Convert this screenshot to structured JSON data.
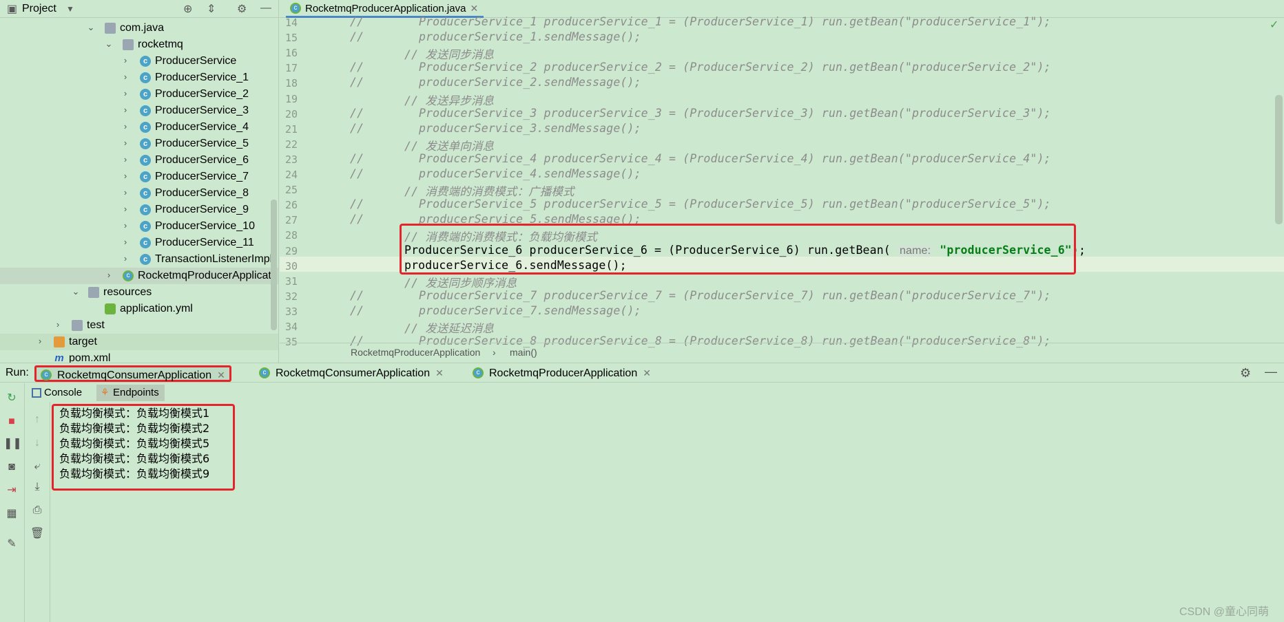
{
  "project": {
    "title": "Project",
    "tree": [
      {
        "label": "com.java",
        "icon": "folder-icon",
        "depth": "pkg"
      },
      {
        "label": "rocketmq",
        "icon": "folder-icon",
        "depth": "sub"
      },
      {
        "label": "ProducerService",
        "icon": "class-icon"
      },
      {
        "label": "ProducerService_1",
        "icon": "class-icon"
      },
      {
        "label": "ProducerService_2",
        "icon": "class-icon"
      },
      {
        "label": "ProducerService_3",
        "icon": "class-icon"
      },
      {
        "label": "ProducerService_4",
        "icon": "class-icon"
      },
      {
        "label": "ProducerService_5",
        "icon": "class-icon"
      },
      {
        "label": "ProducerService_6",
        "icon": "class-icon"
      },
      {
        "label": "ProducerService_7",
        "icon": "class-icon"
      },
      {
        "label": "ProducerService_8",
        "icon": "class-icon"
      },
      {
        "label": "ProducerService_9",
        "icon": "class-icon"
      },
      {
        "label": "ProducerService_10",
        "icon": "class-icon"
      },
      {
        "label": "ProducerService_11",
        "icon": "class-icon"
      },
      {
        "label": "TransactionListenerImpl",
        "icon": "class-icon"
      },
      {
        "label": "RocketmqProducerApplicati",
        "icon": "spring-boot-class-icon"
      },
      {
        "label": "resources",
        "icon": "resources-folder-icon"
      },
      {
        "label": "application.yml",
        "icon": "yml-icon"
      },
      {
        "label": "test",
        "icon": "folder-icon"
      },
      {
        "label": "target",
        "icon": "orange-folder-icon"
      },
      {
        "label": "pom.xml",
        "icon": "maven-icon"
      }
    ]
  },
  "editor": {
    "tab_label": "RocketmqProducerApplication.java",
    "line_numbers": [
      "14",
      "15",
      "16",
      "17",
      "18",
      "19",
      "20",
      "21",
      "22",
      "23",
      "24",
      "25",
      "26",
      "27",
      "28",
      "29",
      "30",
      "31",
      "32",
      "33",
      "34",
      "35"
    ],
    "lines": [
      {
        "prefix": "//",
        "text": "ProducerService_1 producerService_1 = (ProducerService_1) run.getBean(\"producerService_1\");"
      },
      {
        "prefix": "//",
        "text": "producerService_1.sendMessage();"
      },
      {
        "prefix": "",
        "text": "// 发送同步消息"
      },
      {
        "prefix": "//",
        "text": "ProducerService_2 producerService_2 = (ProducerService_2) run.getBean(\"producerService_2\");"
      },
      {
        "prefix": "//",
        "text": "producerService_2.sendMessage();"
      },
      {
        "prefix": "",
        "text": "// 发送异步消息"
      },
      {
        "prefix": "//",
        "text": "ProducerService_3 producerService_3 = (ProducerService_3) run.getBean(\"producerService_3\");"
      },
      {
        "prefix": "//",
        "text": "producerService_3.sendMessage();"
      },
      {
        "prefix": "",
        "text": "// 发送单向消息"
      },
      {
        "prefix": "//",
        "text": "ProducerService_4 producerService_4 = (ProducerService_4) run.getBean(\"producerService_4\");"
      },
      {
        "prefix": "//",
        "text": "producerService_4.sendMessage();"
      },
      {
        "prefix": "",
        "text": "// 消费端的消费模式：广播模式"
      },
      {
        "prefix": "//",
        "text": "ProducerService_5 producerService_5 = (ProducerService_5) run.getBean(\"producerService_5\");"
      },
      {
        "prefix": "//",
        "text": "producerService_5.sendMessage();"
      },
      {
        "prefix": "",
        "text": "// 消费端的消费模式：负载均衡模式"
      },
      {
        "prefix": "",
        "text": ""
      },
      {
        "prefix": "",
        "text": "producerService_6.sendMessage();"
      },
      {
        "prefix": "",
        "text": "// 发送同步顺序消息"
      },
      {
        "prefix": "//",
        "text": "ProducerService_7 producerService_7 = (ProducerService_7) run.getBean(\"producerService_7\");"
      },
      {
        "prefix": "//",
        "text": "producerService_7.sendMessage();"
      },
      {
        "prefix": "",
        "text": "// 发送延迟消息"
      },
      {
        "prefix": "//",
        "text": "ProducerService_8 producerService_8 = (ProducerService_8) run.getBean(\"producerService_8\");"
      }
    ],
    "line29": {
      "code": "ProducerService_6 producerService_6 = (ProducerService_6) run.getBean(",
      "hint": "name:",
      "string": "\"producerService_6\"",
      "end": ");"
    },
    "breadcrumb": {
      "class": "RocketmqProducerApplication",
      "sep": "›",
      "method": "main()"
    }
  },
  "run": {
    "label": "Run:",
    "tabs": [
      {
        "label": "RocketmqConsumerApplication"
      },
      {
        "label": "RocketmqConsumerApplication"
      },
      {
        "label": "RocketmqProducerApplication"
      }
    ],
    "console_tabs": {
      "console": "Console",
      "endpoints": "Endpoints"
    },
    "output": [
      "负载均衡模式：负载均衡模式1",
      "负载均衡模式：负载均衡模式2",
      "负载均衡模式：负载均衡模式5",
      "负载均衡模式：负载均衡模式6",
      "负载均衡模式：负载均衡模式9"
    ]
  },
  "watermark": "CSDN @童心同萌",
  "colors": {
    "background": "#cce8cf",
    "highlight_box": "#e3242b",
    "string": "#067d17",
    "comment": "#8c8c8c"
  }
}
